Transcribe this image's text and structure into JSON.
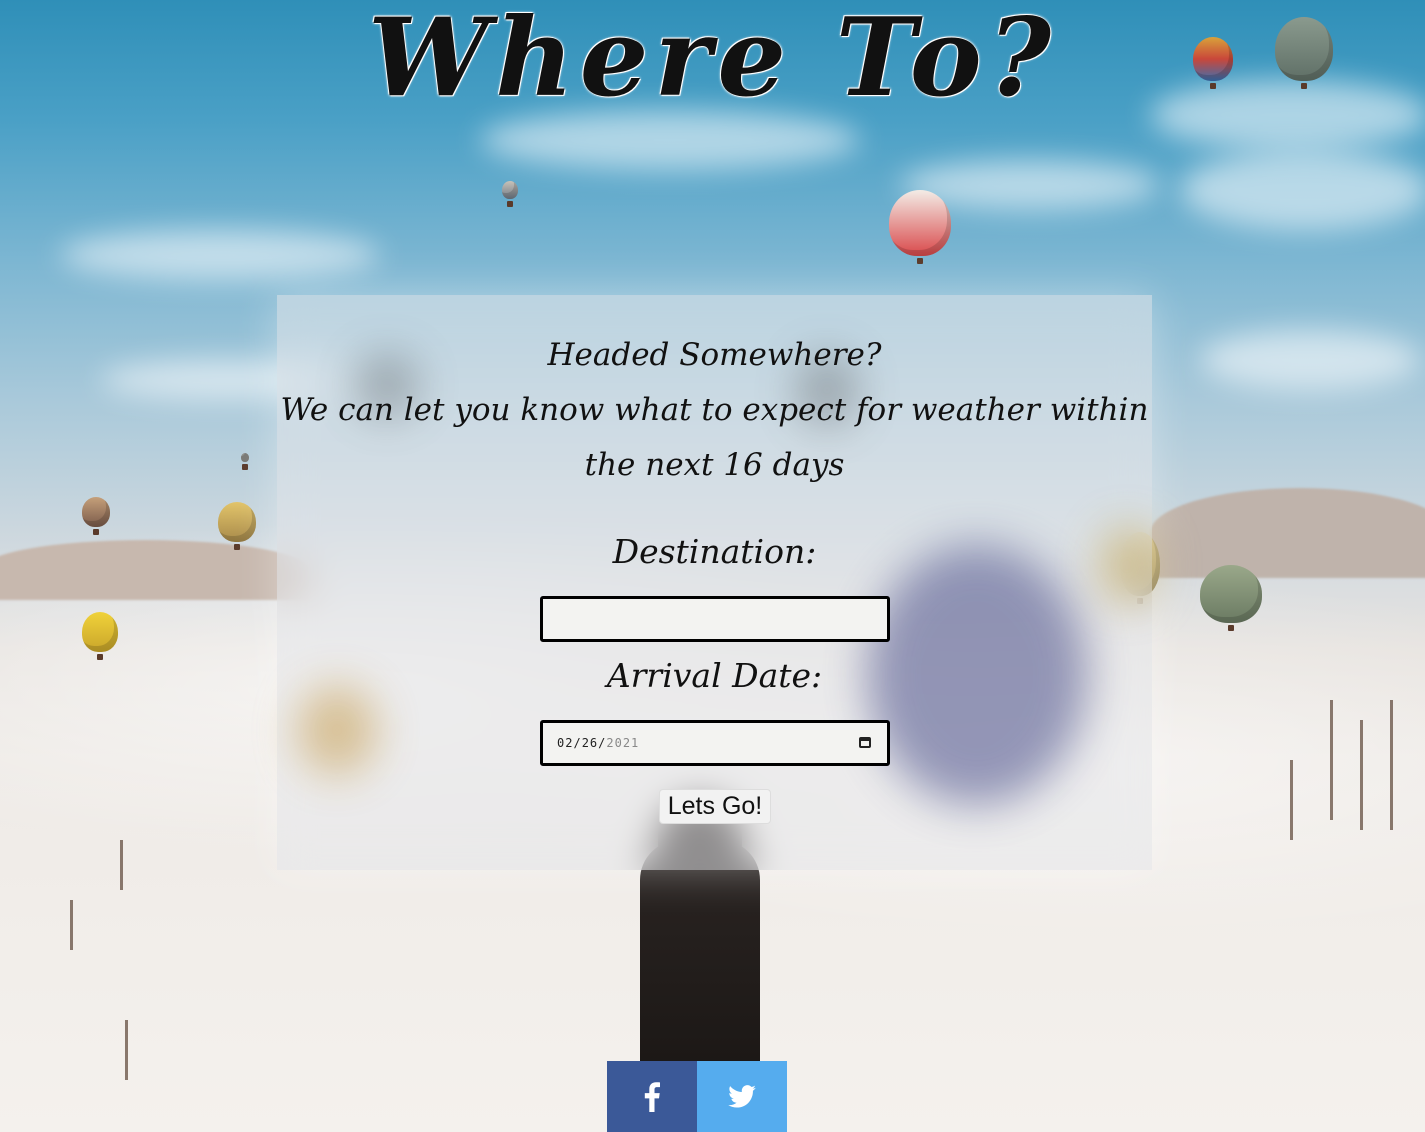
{
  "header": {
    "title": "Where To?"
  },
  "intro": {
    "line1": "Headed Somewhere?",
    "line2": "We can let you know what to expect for weather within the next 16 days"
  },
  "form": {
    "destination_label": "Destination:",
    "destination_value": "",
    "arrival_label": "Arrival Date:",
    "arrival_month": "02",
    "arrival_day": "26",
    "arrival_year": "2021",
    "submit_label": "Lets Go!"
  },
  "social": {
    "facebook_icon": "facebook-icon",
    "twitter_icon": "twitter-icon",
    "facebook_color": "#3b5998",
    "twitter_color": "#55acee"
  }
}
